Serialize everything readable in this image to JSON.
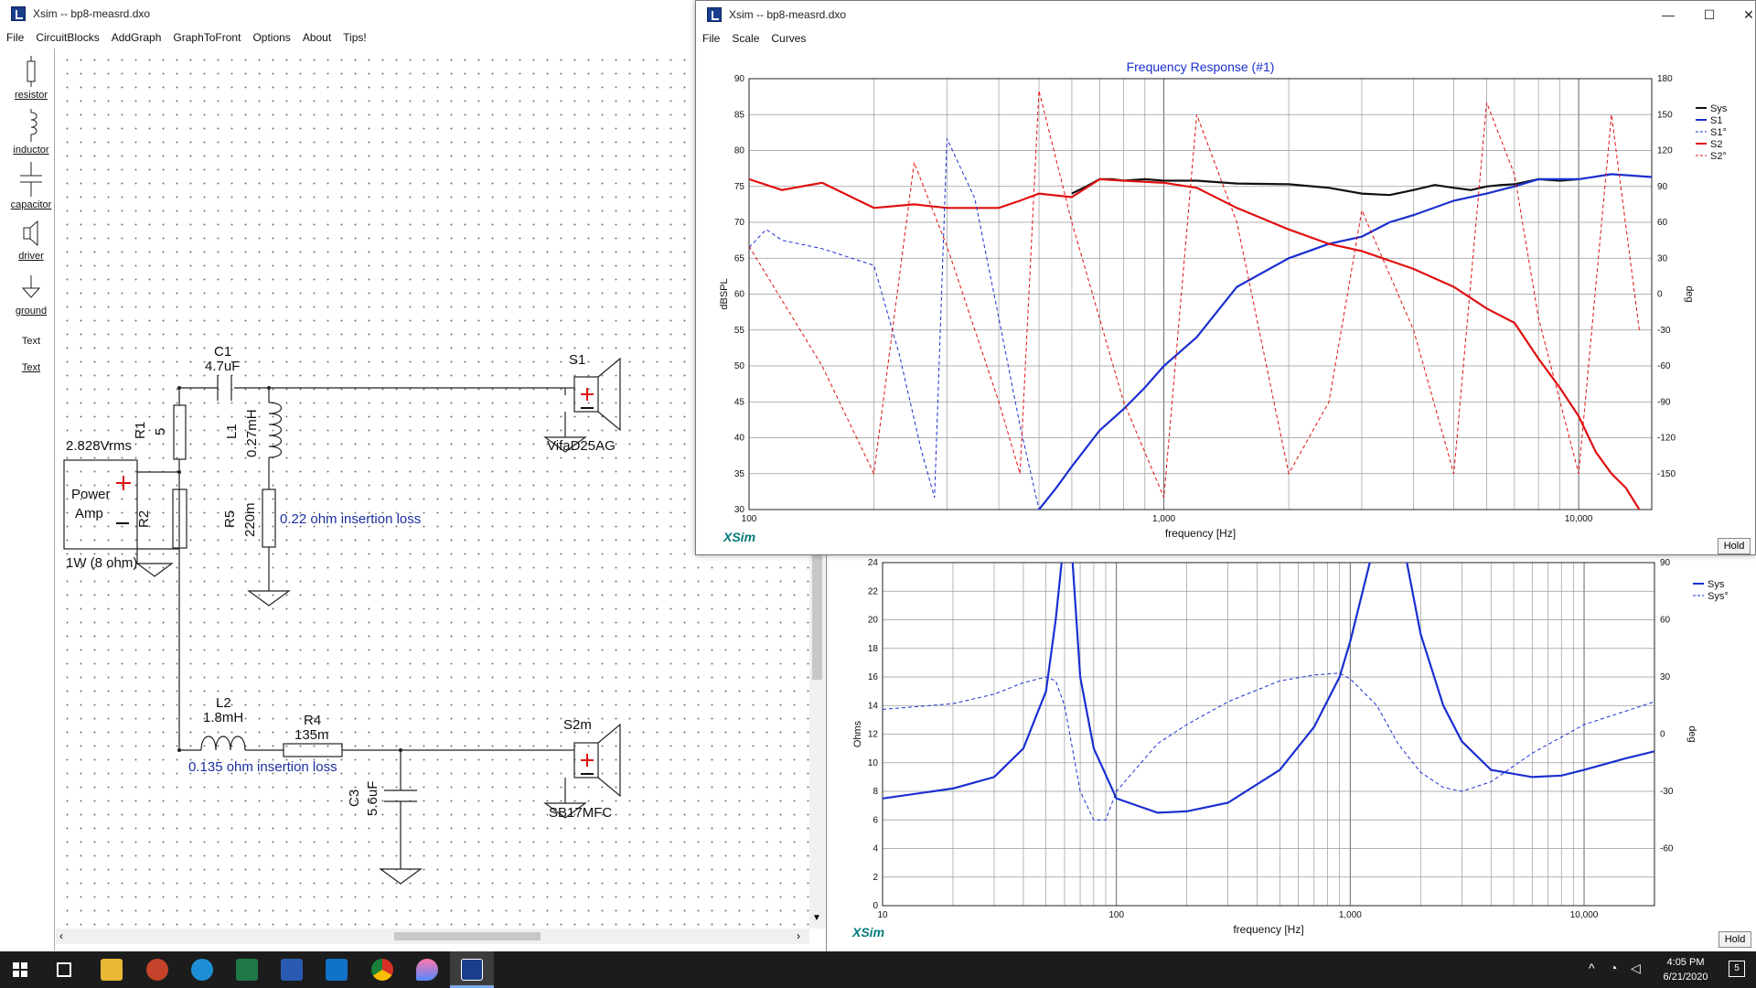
{
  "schem": {
    "title": "Xsim -- bp8-measrd.dxo",
    "menu": [
      "File",
      "CircuitBlocks",
      "AddGraph",
      "GraphToFront",
      "Options",
      "About",
      "Tips!"
    ]
  },
  "tools": [
    "resistor",
    "inductor",
    "capacitor",
    "driver",
    "ground",
    "Text",
    "Text"
  ],
  "circuit": {
    "c1": "C1",
    "c1v": "4.7uF",
    "l1": "L1",
    "l1v": "0.27mH",
    "r1": "R1",
    "r1v": "5",
    "r2": "R2",
    "r5": "R5",
    "r5v": "220m",
    "r5note": "0.22 ohm insertion loss",
    "src_v": "2.828Vrms",
    "src_a": "Power",
    "src_b": "Amp",
    "src_p": "1W (8 ohm)",
    "s1": "S1",
    "s1d": "VifaD25AG",
    "l2": "L2",
    "l2v": "1.8mH",
    "r4": "R4",
    "r4v": "135m",
    "r4note": "0.135 ohm insertion loss",
    "c3": "C3",
    "c3v": "5.6uF",
    "s2": "S2m",
    "s2d": "SB17MFC"
  },
  "fr": {
    "title": "Xsim -- bp8-measrd.dxo",
    "menu": [
      "File",
      "Scale",
      "Curves"
    ],
    "hold": "Hold",
    "brand": "XSim"
  },
  "imp": {
    "hold": "Hold",
    "brand": "XSim"
  },
  "taskbar": {
    "time": "4:05 PM",
    "date": "6/21/2020",
    "notif": "5"
  },
  "chart_data": [
    {
      "type": "line",
      "title": "Frequency Response (#1)",
      "xlabel": "frequency [Hz]",
      "ylabel": "dBSPL",
      "y2label": "deg",
      "xscale": "log",
      "xlim": [
        100,
        15000
      ],
      "ylim": [
        30,
        90
      ],
      "y2lim": [
        -180,
        180
      ],
      "yticks": [
        "90",
        "85",
        "80",
        "75",
        "70",
        "65",
        "60",
        "55",
        "50",
        "45",
        "40",
        "35",
        "30"
      ],
      "y2ticks": [
        "180",
        "150",
        "120",
        "90",
        "60",
        "30",
        "0",
        "-30",
        "-60",
        "-90",
        "-120",
        "-150"
      ],
      "xticks": [
        "100",
        "1,000",
        "10,000"
      ],
      "legend": [
        "Sys",
        "S1",
        "S1°",
        "S2",
        "S2°"
      ],
      "series": [
        {
          "name": "Sys",
          "color": "#111111",
          "x": [
            600,
            650,
            700,
            750,
            800,
            900,
            1000,
            1200,
            1500,
            2000,
            2500,
            3000,
            3500,
            4000,
            4500,
            5000,
            5500,
            6000,
            6500,
            7000,
            8000,
            9000,
            10000
          ],
          "y": [
            74,
            75,
            76,
            76,
            75.8,
            76,
            75.8,
            75.8,
            75.4,
            75.3,
            74.8,
            74,
            73.8,
            74.5,
            75.2,
            74.8,
            74.5,
            75,
            75.2,
            75.3,
            76,
            75.8,
            76
          ]
        },
        {
          "name": "S1",
          "color": "#1a2fd0",
          "x": [
            500,
            550,
            600,
            700,
            800,
            900,
            1000,
            1200,
            1500,
            2000,
            2500,
            3000,
            3500,
            4000,
            5000,
            6000,
            7000,
            8000,
            9000,
            10000,
            12000,
            15000
          ],
          "y": [
            30,
            33,
            36,
            41,
            44,
            47,
            50,
            54,
            61,
            65,
            67,
            68,
            70,
            71,
            73,
            74,
            75,
            76,
            76,
            76,
            76.7,
            76.3
          ]
        },
        {
          "name": "S2",
          "color": "#e01010",
          "x": [
            100,
            120,
            150,
            200,
            250,
            300,
            400,
            450,
            500,
            600,
            700,
            800,
            1000,
            1200,
            1500,
            2000,
            2500,
            3000,
            4000,
            5000,
            6000,
            7000,
            8000,
            9000,
            10000,
            11000,
            12000,
            13000,
            14000
          ],
          "y": [
            76,
            74.5,
            75.5,
            72,
            72.5,
            72,
            72,
            73,
            74,
            73.5,
            76,
            75.8,
            75.5,
            74.8,
            72,
            69,
            67,
            66,
            63.5,
            61,
            58,
            56,
            51,
            47,
            43,
            38,
            35,
            33,
            30
          ]
        },
        {
          "name": "S1°",
          "color": "#1a2fd0",
          "dashed": true,
          "x": [
            100,
            110,
            120,
            150,
            200,
            230,
            260,
            280,
            300,
            350,
            400,
            450,
            500
          ],
          "y": [
            39,
            54,
            45,
            38,
            24,
            -50,
            -130,
            -170,
            130,
            80,
            -20,
            -110,
            -180
          ]
        },
        {
          "name": "S2°",
          "color": "#e01010",
          "dashed": true,
          "x": [
            100,
            150,
            200,
            250,
            300,
            400,
            450,
            500,
            600,
            800,
            1000,
            1200,
            1500,
            2000,
            2500,
            3000,
            4000,
            5000,
            6000,
            7000,
            8000,
            10000,
            12000,
            14000
          ],
          "y": [
            40,
            -60,
            -150,
            110,
            40,
            -90,
            -150,
            170,
            60,
            -90,
            -170,
            150,
            60,
            -150,
            -90,
            70,
            -30,
            -150,
            160,
            100,
            -20,
            -150,
            150,
            -30
          ]
        }
      ]
    },
    {
      "type": "line",
      "xlabel": "frequency [Hz]",
      "ylabel": "Ohms",
      "y2label": "deg",
      "xscale": "log",
      "xlim": [
        10,
        20000
      ],
      "ylim": [
        0,
        24
      ],
      "y2lim": [
        -90,
        90
      ],
      "yticks": [
        "24",
        "22",
        "20",
        "18",
        "16",
        "14",
        "12",
        "10",
        "8",
        "6",
        "4",
        "2",
        "0"
      ],
      "y2ticks": [
        "90",
        "60",
        "30",
        "0",
        "-30",
        "-60"
      ],
      "xticks": [
        "10",
        "100",
        "1,000",
        "10,000"
      ],
      "legend": [
        "Sys",
        "Sys°"
      ],
      "series": [
        {
          "name": "Sys",
          "color": "#1a2fd0",
          "x": [
            10,
            20,
            30,
            40,
            50,
            55,
            60,
            65,
            70,
            80,
            100,
            150,
            200,
            300,
            500,
            700,
            900,
            1000,
            1300,
            1500,
            1700,
            2000,
            2500,
            3000,
            4000,
            6000,
            8000,
            10000,
            15000,
            20000
          ],
          "y": [
            7.5,
            8.2,
            9,
            11,
            15,
            20,
            26,
            24,
            16,
            11,
            7.5,
            6.5,
            6.6,
            7.2,
            9.5,
            12.5,
            16,
            18.5,
            26,
            28,
            25,
            19,
            14,
            11.5,
            9.5,
            9,
            9.1,
            9.5,
            10.3,
            10.8
          ]
        },
        {
          "name": "Sys°",
          "color": "#1a2fd0",
          "dashed": true,
          "x": [
            10,
            20,
            30,
            40,
            50,
            55,
            60,
            70,
            80,
            90,
            100,
            150,
            200,
            300,
            500,
            700,
            900,
            1000,
            1300,
            1600,
            2000,
            2500,
            3000,
            4000,
            6000,
            10000,
            20000
          ],
          "y": [
            13,
            16,
            21,
            27,
            30,
            28,
            15,
            -30,
            -45,
            -45,
            -30,
            -5,
            5,
            17,
            28,
            31,
            32,
            29,
            15,
            -5,
            -20,
            -28,
            -30,
            -25,
            -10,
            5,
            17
          ]
        }
      ]
    }
  ]
}
